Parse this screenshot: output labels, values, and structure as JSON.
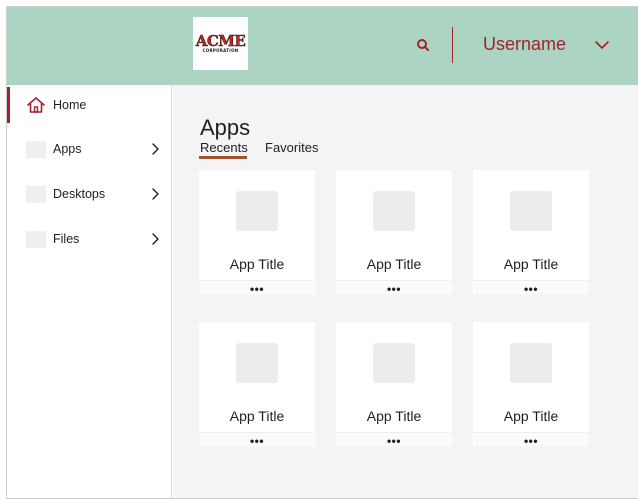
{
  "header": {
    "logo_text": "ACME",
    "logo_subtext": "CORPORATION",
    "search_icon": "search-icon",
    "username": "Username",
    "user_menu_icon": "chevron-down-icon"
  },
  "sidebar": {
    "items": [
      {
        "label": "Home",
        "icon": "home-icon",
        "active": true
      },
      {
        "label": "Apps",
        "icon": "placeholder-icon",
        "chevron": "chevron-right-icon"
      },
      {
        "label": "Desktops",
        "icon": "placeholder-icon",
        "chevron": "chevron-right-icon"
      },
      {
        "label": "Files",
        "icon": "placeholder-icon",
        "chevron": "chevron-right-icon"
      }
    ]
  },
  "main": {
    "title": "Apps",
    "tabs": [
      {
        "label": "Recents",
        "active": true
      },
      {
        "label": "Favorites",
        "active": false
      }
    ],
    "cards": [
      {
        "title": "App Title",
        "more": "•••"
      },
      {
        "title": "App Title",
        "more": "•••"
      },
      {
        "title": "App Title",
        "more": "•••"
      },
      {
        "title": "App Title",
        "more": "•••"
      },
      {
        "title": "App Title",
        "more": "•••"
      },
      {
        "title": "App Title",
        "more": "•••"
      }
    ]
  },
  "colors": {
    "header_bg": "#abd5c2",
    "accent": "#a3222a",
    "content_bg": "#f4f4f4"
  }
}
